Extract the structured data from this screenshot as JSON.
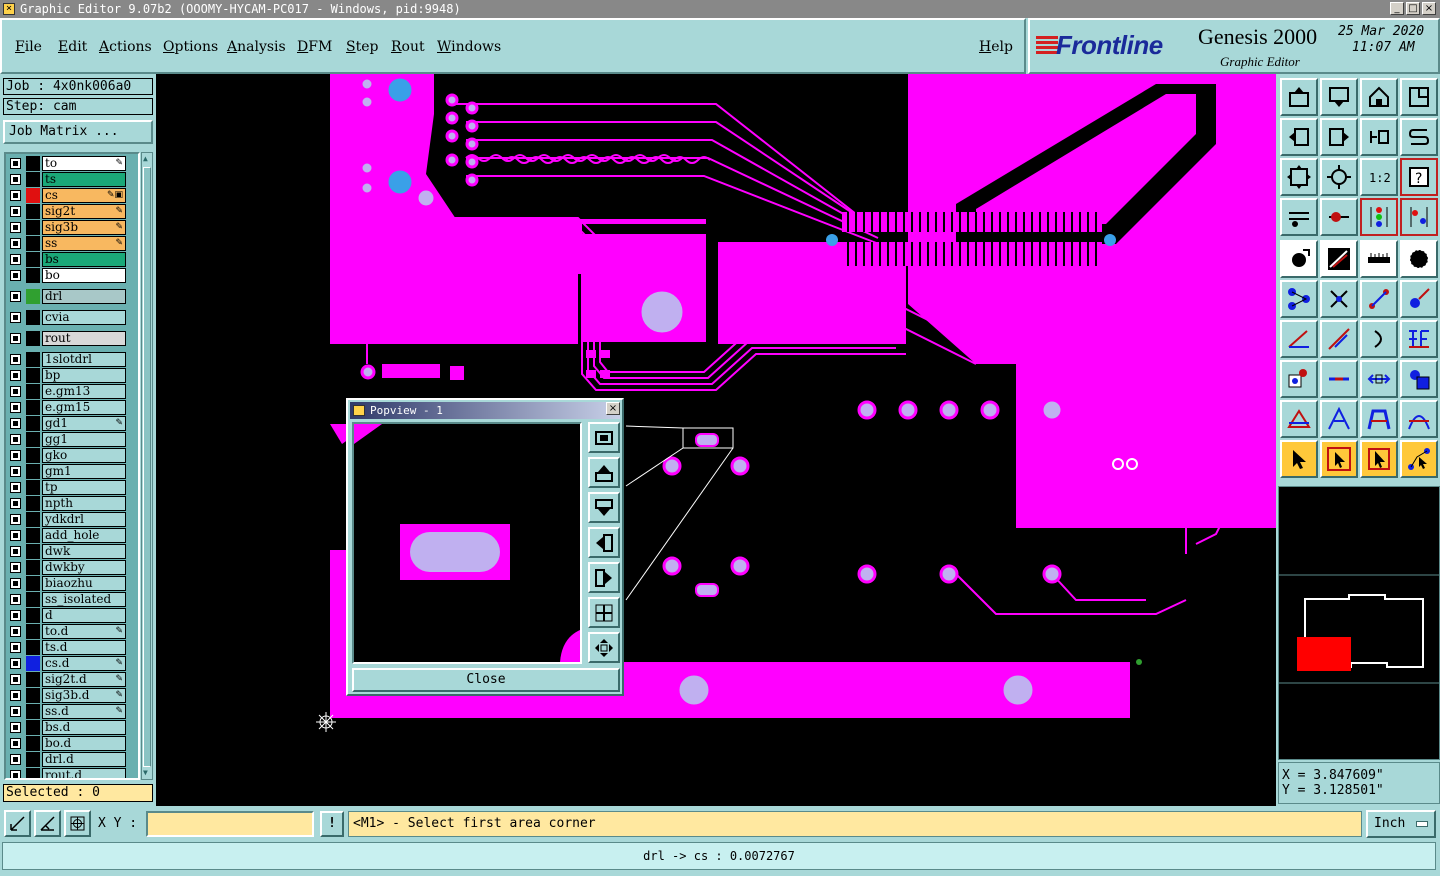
{
  "window": {
    "title": "Graphic Editor 9.07b2 (OOOMY-HYCAM-PC017 - Windows, pid:9948)",
    "controls": [
      "_",
      "□",
      "×"
    ]
  },
  "menu": {
    "items": [
      "File",
      "Edit",
      "Actions",
      "Options",
      "Analysis",
      "DFM",
      "Step",
      "Rout",
      "Windows"
    ],
    "help": "Help"
  },
  "logo": {
    "brand": "Frontline",
    "product": "Genesis 2000",
    "subtitle": "Graphic Editor",
    "date": "25 Mar 2020",
    "time": "11:07 AM"
  },
  "job": {
    "job_label": "Job : 4x0nk006a0",
    "step_label": "Step: cam",
    "matrix_button": "Job Matrix ..."
  },
  "layers": [
    {
      "name": "to",
      "color": "#000000",
      "bg": "#ffffff",
      "flag": "✎"
    },
    {
      "name": "ts",
      "color": "#000000",
      "bg": "#1aa878",
      "flag": ""
    },
    {
      "name": "cs",
      "color": "#e01010",
      "bg": "#f8b860",
      "flag": "✎▣"
    },
    {
      "name": "sig2t",
      "color": "#000000",
      "bg": "#f8b860",
      "flag": "✎"
    },
    {
      "name": "sig3b",
      "color": "#000000",
      "bg": "#f8b860",
      "flag": "✎"
    },
    {
      "name": "ss",
      "color": "#000000",
      "bg": "#f8b860",
      "flag": "✎"
    },
    {
      "name": "bs",
      "color": "#000000",
      "bg": "#1aa878",
      "flag": ""
    },
    {
      "name": "bo",
      "color": "#000000",
      "bg": "#ffffff",
      "flag": ""
    },
    {
      "name": "drl",
      "color": "#30a030",
      "bg": "#a8c8c8",
      "flag": ""
    },
    {
      "name": "cvia",
      "color": "#000000",
      "bg": "#a8d8d8",
      "flag": ""
    },
    {
      "name": "rout",
      "color": "#000000",
      "bg": "#d8d8d8",
      "flag": ""
    },
    {
      "name": "1slotdrl",
      "color": "#000000",
      "bg": "#a8d8d8",
      "flag": ""
    },
    {
      "name": "bp",
      "color": "#000000",
      "bg": "#a8d8d8",
      "flag": ""
    },
    {
      "name": "e.gm13",
      "color": "#000000",
      "bg": "#a8d8d8",
      "flag": ""
    },
    {
      "name": "e.gm15",
      "color": "#000000",
      "bg": "#a8d8d8",
      "flag": ""
    },
    {
      "name": "gd1",
      "color": "#000000",
      "bg": "#a8d8d8",
      "flag": "✎"
    },
    {
      "name": "gg1",
      "color": "#000000",
      "bg": "#a8d8d8",
      "flag": ""
    },
    {
      "name": "gko",
      "color": "#000000",
      "bg": "#a8d8d8",
      "flag": ""
    },
    {
      "name": "gm1",
      "color": "#000000",
      "bg": "#a8d8d8",
      "flag": ""
    },
    {
      "name": "tp",
      "color": "#000000",
      "bg": "#a8d8d8",
      "flag": ""
    },
    {
      "name": "npth",
      "color": "#000000",
      "bg": "#a8d8d8",
      "flag": ""
    },
    {
      "name": "ydkdrl",
      "color": "#000000",
      "bg": "#a8d8d8",
      "flag": ""
    },
    {
      "name": "add_hole",
      "color": "#000000",
      "bg": "#a8d8d8",
      "flag": ""
    },
    {
      "name": "dwk",
      "color": "#000000",
      "bg": "#a8d8d8",
      "flag": ""
    },
    {
      "name": "dwkby",
      "color": "#000000",
      "bg": "#a8d8d8",
      "flag": ""
    },
    {
      "name": "biaozhu",
      "color": "#000000",
      "bg": "#a8d8d8",
      "flag": ""
    },
    {
      "name": "ss_isolated",
      "color": "#000000",
      "bg": "#a8d8d8",
      "flag": ""
    },
    {
      "name": "d",
      "color": "#000000",
      "bg": "#a8d8d8",
      "flag": ""
    },
    {
      "name": "to.d",
      "color": "#000000",
      "bg": "#a8d8d8",
      "flag": "✎"
    },
    {
      "name": "ts.d",
      "color": "#000000",
      "bg": "#a8d8d8",
      "flag": ""
    },
    {
      "name": "cs.d",
      "color": "#1020e0",
      "bg": "#a8d8d8",
      "flag": "✎"
    },
    {
      "name": "sig2t.d",
      "color": "#000000",
      "bg": "#a8d8d8",
      "flag": "✎"
    },
    {
      "name": "sig3b.d",
      "color": "#000000",
      "bg": "#a8d8d8",
      "flag": "✎"
    },
    {
      "name": "ss.d",
      "color": "#000000",
      "bg": "#a8d8d8",
      "flag": "✎"
    },
    {
      "name": "bs.d",
      "color": "#000000",
      "bg": "#a8d8d8",
      "flag": ""
    },
    {
      "name": "bo.d",
      "color": "#000000",
      "bg": "#a8d8d8",
      "flag": ""
    },
    {
      "name": "drl.d",
      "color": "#000000",
      "bg": "#a8d8d8",
      "flag": ""
    },
    {
      "name": "rout.d",
      "color": "#000000",
      "bg": "#a8d8d8",
      "flag": ""
    }
  ],
  "selected_label": "Selected : 0",
  "popview": {
    "title": "Popview - 1",
    "close_label": "Close",
    "tools": [
      "zoom-fit-icon",
      "pan-up-icon",
      "pan-down-icon",
      "pan-left-icon",
      "pan-right-icon",
      "zoom-in-icon",
      "zoom-out-icon"
    ]
  },
  "coords": {
    "x": "X = 3.847609\"",
    "y": "Y = 3.128501\""
  },
  "bottom": {
    "xy_label": "X Y :",
    "xy_value": "",
    "prompt_btn": "!",
    "prompt": "<M1> - Select first area corner",
    "units": "Inch"
  },
  "status": "drl -> cs : 0.0072767",
  "colors": {
    "copper": "#ff00ff",
    "pad": "#c0b0f0",
    "panel": "#a8d8d8",
    "canvas": "#000000"
  }
}
